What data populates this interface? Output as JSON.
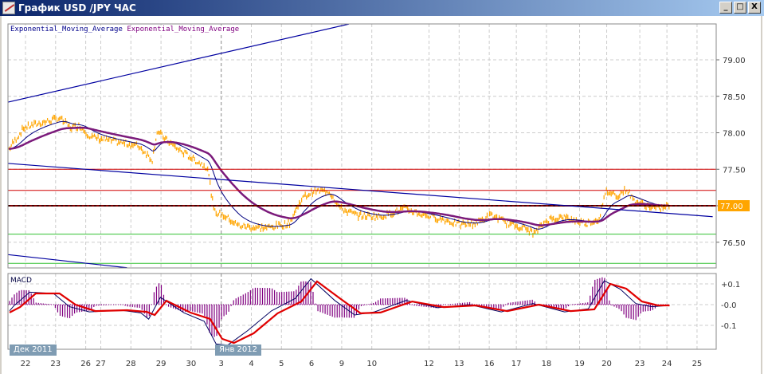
{
  "window": {
    "title": "График USD /JPY  ЧАС",
    "minimize_glyph": "_",
    "maximize_glyph": "□",
    "close_glyph": "X"
  },
  "legend": {
    "fast": "Exponential_Moving_Average",
    "slow": "Exponential_Moving_Average",
    "fast_color": "#00008b",
    "slow_color": "#800080"
  },
  "macd_panel": {
    "label": "MACD"
  },
  "date_tags": [
    "Дек 2011",
    "Янв 2012"
  ],
  "current_price_label": "77.00",
  "colors": {
    "price": "#ffa500",
    "ema_fast": "#000080",
    "ema_slow": "#7b1a7b",
    "macd": "#000060",
    "signal": "#e00000",
    "hist": "#800080",
    "resistance": "#d00000",
    "support": "#30c030",
    "trend": "#0000a0",
    "price_tag": "#ffa500"
  },
  "chart_data": [
    {
      "type": "line",
      "title": "USD/JPY H1",
      "ylim": [
        76.15,
        79.6
      ],
      "y_ticks": [
        "79.00",
        "78.50",
        "78.00",
        "77.50",
        "77.00",
        "76.50"
      ],
      "y_tick_values": [
        79.0,
        78.5,
        78.0,
        77.5,
        77.0,
        76.5
      ],
      "x_ticks": [
        {
          "label": "22",
          "u": 0
        },
        {
          "label": "23",
          "u": 1
        },
        {
          "label": "26",
          "u": 2
        },
        {
          "label": "27",
          "u": 2.5
        },
        {
          "label": "28",
          "u": 3.5
        },
        {
          "label": "29",
          "u": 4.5
        },
        {
          "label": "30",
          "u": 5.5
        },
        {
          "label": "3",
          "u": 6.5
        },
        {
          "label": "4",
          "u": 7.5
        },
        {
          "label": "5",
          "u": 8.5
        },
        {
          "label": "6",
          "u": 9.5
        },
        {
          "label": "9",
          "u": 10.5
        },
        {
          "label": "10",
          "u": 11.5
        },
        {
          "label": "12",
          "u": 13.4
        },
        {
          "label": "13",
          "u": 14.4
        },
        {
          "label": "16",
          "u": 15.4
        },
        {
          "label": "17",
          "u": 16.3
        },
        {
          "label": "18",
          "u": 17.3
        },
        {
          "label": "19",
          "u": 18.4
        },
        {
          "label": "20",
          "u": 19.3
        },
        {
          "label": "23",
          "u": 20.4
        },
        {
          "label": "24",
          "u": 21.3
        },
        {
          "label": "25",
          "u": 22.3
        }
      ],
      "price": [
        [
          -0.55,
          77.78
        ],
        [
          -0.05,
          78.07
        ],
        [
          0.47,
          78.13
        ],
        [
          1.13,
          78.2
        ],
        [
          1.5,
          78.07
        ],
        [
          1.79,
          78.1
        ],
        [
          2.18,
          77.94
        ],
        [
          2.71,
          77.9
        ],
        [
          3.37,
          77.85
        ],
        [
          3.76,
          77.82
        ],
        [
          4.21,
          77.63
        ],
        [
          4.37,
          78.02
        ],
        [
          4.68,
          77.9
        ],
        [
          5.08,
          77.77
        ],
        [
          5.61,
          77.63
        ],
        [
          6.05,
          77.52
        ],
        [
          6.26,
          76.92
        ],
        [
          6.66,
          76.85
        ],
        [
          7.05,
          76.73
        ],
        [
          7.58,
          76.7
        ],
        [
          8.1,
          76.7
        ],
        [
          8.76,
          76.76
        ],
        [
          9.16,
          77.09
        ],
        [
          9.55,
          77.2
        ],
        [
          10.08,
          77.2
        ],
        [
          10.47,
          76.96
        ],
        [
          11.0,
          76.87
        ],
        [
          11.79,
          76.85
        ],
        [
          12.58,
          76.96
        ],
        [
          13.1,
          76.89
        ],
        [
          13.89,
          76.81
        ],
        [
          14.42,
          76.74
        ],
        [
          14.95,
          76.76
        ],
        [
          15.47,
          76.87
        ],
        [
          16.0,
          76.76
        ],
        [
          16.53,
          76.7
        ],
        [
          16.92,
          76.62
        ],
        [
          17.32,
          76.81
        ],
        [
          17.84,
          76.84
        ],
        [
          18.63,
          76.76
        ],
        [
          19.03,
          76.81
        ],
        [
          19.29,
          77.2
        ],
        [
          19.68,
          77.14
        ],
        [
          19.95,
          77.23
        ],
        [
          20.21,
          77.07
        ],
        [
          20.61,
          77.0
        ],
        [
          21.0,
          76.96
        ],
        [
          21.39,
          77.0
        ]
      ],
      "hlines": [
        {
          "value": 77.5,
          "kind": "resistance"
        },
        {
          "value": 77.21,
          "kind": "resistance"
        },
        {
          "value": 77.0,
          "kind": "current"
        },
        {
          "value": 76.61,
          "kind": "support"
        },
        {
          "value": 76.21,
          "kind": "support"
        }
      ],
      "trendlines": [
        [
          [
            -0.58,
            78.42
          ],
          [
            10.74,
            79.49
          ]
        ],
        [
          [
            -0.58,
            77.58
          ],
          [
            22.82,
            76.85
          ]
        ],
        [
          [
            -0.58,
            76.33
          ],
          [
            3.37,
            76.15
          ]
        ]
      ]
    },
    {
      "type": "line",
      "title": "MACD",
      "ylim": [
        -0.215,
        0.15
      ],
      "y_ticks": [
        "+0.1",
        "-0.0",
        "-0.1"
      ],
      "y_tick_values": [
        0.1,
        0,
        -0.1
      ],
      "signal": [
        [
          -0.53,
          -0.038
        ],
        [
          -0.18,
          -0.012
        ],
        [
          0.34,
          0.054
        ],
        [
          1.13,
          0.054
        ],
        [
          1.66,
          0.0
        ],
        [
          2.32,
          -0.031
        ],
        [
          3.37,
          -0.027
        ],
        [
          4.03,
          -0.035
        ],
        [
          4.29,
          -0.05
        ],
        [
          4.68,
          0.019
        ],
        [
          5.47,
          -0.038
        ],
        [
          6.13,
          -0.069
        ],
        [
          6.53,
          -0.165
        ],
        [
          6.92,
          -0.185
        ],
        [
          7.58,
          -0.138
        ],
        [
          8.37,
          -0.042
        ],
        [
          9.16,
          0.015
        ],
        [
          9.68,
          0.112
        ],
        [
          10.47,
          0.027
        ],
        [
          11.13,
          -0.042
        ],
        [
          11.79,
          -0.038
        ],
        [
          12.84,
          0.015
        ],
        [
          13.89,
          -0.012
        ],
        [
          14.95,
          -0.004
        ],
        [
          16.0,
          -0.031
        ],
        [
          17.05,
          0.0
        ],
        [
          18.1,
          -0.031
        ],
        [
          18.89,
          -0.023
        ],
        [
          19.42,
          0.1
        ],
        [
          19.95,
          0.077
        ],
        [
          20.47,
          0.015
        ],
        [
          21.0,
          -0.004
        ],
        [
          21.39,
          -0.004
        ]
      ],
      "macd": [
        [
          -0.53,
          -0.03
        ],
        [
          -0.38,
          -0.005
        ],
        [
          0.14,
          0.06
        ],
        [
          0.93,
          0.054
        ],
        [
          1.46,
          -0.01
        ],
        [
          2.12,
          -0.035
        ],
        [
          3.17,
          -0.027
        ],
        [
          3.83,
          -0.04
        ],
        [
          4.09,
          -0.07
        ],
        [
          4.48,
          0.035
        ],
        [
          5.27,
          -0.04
        ],
        [
          5.93,
          -0.08
        ],
        [
          6.33,
          -0.19
        ],
        [
          6.72,
          -0.195
        ],
        [
          7.38,
          -0.125
        ],
        [
          8.17,
          -0.03
        ],
        [
          8.96,
          0.03
        ],
        [
          9.48,
          0.125
        ],
        [
          10.27,
          0.02
        ],
        [
          10.93,
          -0.05
        ],
        [
          11.59,
          -0.035
        ],
        [
          12.64,
          0.02
        ],
        [
          13.69,
          -0.015
        ],
        [
          14.75,
          0.0
        ],
        [
          15.8,
          -0.035
        ],
        [
          16.85,
          0.005
        ],
        [
          17.9,
          -0.035
        ],
        [
          18.69,
          -0.02
        ],
        [
          19.22,
          0.115
        ],
        [
          19.75,
          0.075
        ],
        [
          20.27,
          0.005
        ],
        [
          20.8,
          -0.01
        ],
        [
          21.39,
          -0.004
        ]
      ]
    }
  ]
}
